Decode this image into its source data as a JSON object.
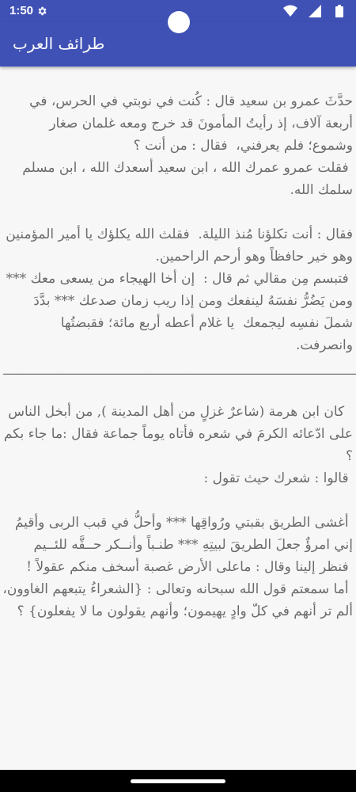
{
  "status_bar": {
    "time": "1:50",
    "icons": [
      "gear-icon",
      "wifi-icon",
      "signal-icon",
      "battery-icon"
    ]
  },
  "app_bar": {
    "title": "طرائف العرب",
    "color": "#3f51b5"
  },
  "content": {
    "story1_p1": "حدَّثَ عمرو بن سعيد قال : كُنت في نوبتي في الحرس، في أربعة آلاف، إذ رأيتُ المأمونَ قد خرج ومعه غلمان صغار وشموع؛ فلم يعرفني،  فقال : من أنت ؟\n فقلت عمرو عمرك الله ، ابن سعيد أسعدك الله ، ابن مسلم سلمك الله.",
    "story1_p2": "فقال : أنت تكلؤنا مُنذ الليلة.  فقلث الله يكلؤك يا أمير المؤمنين وهو خير حافظاً وهو أرحم الراحمين.\n فتبسم مِن مقالي ثم قال :  إن أخا الهيجاء من يسعى معك *** ومن يَضُرُّ نفسَهُ لينفعك ومن إذا ريب زمان صدعك *** بدَّدَ شملَ نفسِه ليجمعك  يا غلام أعطه أربع مائة؛ فقبضتُها وانصرفت.",
    "divider": "____________________________________________________________",
    "story2_p1": "  كان ابن هرمة (شاعرٌ غزلٍ من أهل المدينة ), من أبخل الناس على ادّعائه الكرمَ في شعره فأتاه يوماً جماعة فقال :ما جاء بكم ؟\n قالوا : شعرك حيث تقول :",
    "story2_p2": " أغشى الطريق بقبتي ورُواقِها *** وأحلُّ في قبب الربى وأقيمُ إني امرؤٌ جعلَ الطريقَ لبيتِهِ *** طنـباً وأنــكر حــقَّه للئــيم\n فنظر إلينا وقال : ماعلى الأرض غصبة أسخف منكم عقولاً !\n أما سمعتم قول الله سبحانه وتعالى : {الشعراءُ يتبعهم الغاوون، ألم تر أنهم في كلّ وادٍ يهيمون؛ وأنهم يقولون ما لا يفعلون} ؟"
  }
}
